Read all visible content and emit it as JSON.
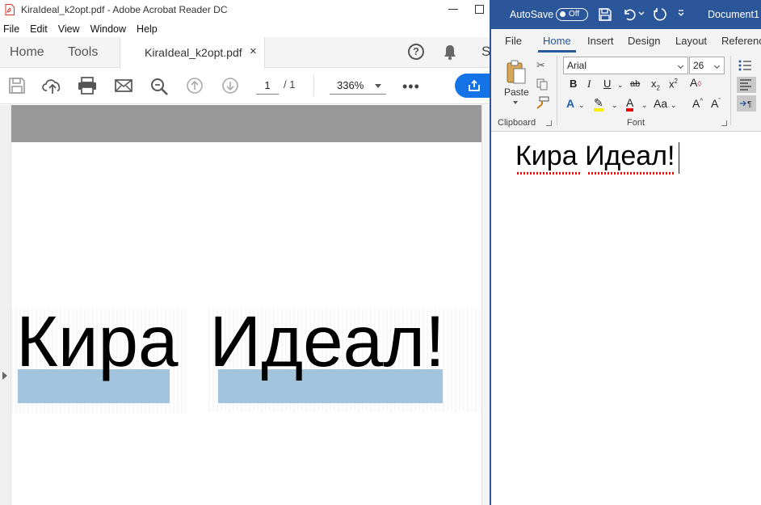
{
  "acrobat": {
    "window_title": "KiraIdeal_k2opt.pdf - Adobe Acrobat Reader DC",
    "menu": [
      "File",
      "Edit",
      "View",
      "Window",
      "Help"
    ],
    "tabs": {
      "home": "Home",
      "tools": "Tools",
      "document": "KiraIdeal_k2opt.pdf",
      "close": "×"
    },
    "share_initial": "S",
    "toolbar": {
      "page_current": "1",
      "page_total": "/ 1",
      "zoom": "336%"
    },
    "document_text": "Кира Идеал!"
  },
  "word": {
    "autosave_label": "AutoSave",
    "autosave_state": "Off",
    "doc_name": "Document1",
    "tabs": [
      "File",
      "Home",
      "Insert",
      "Design",
      "Layout",
      "Referenc"
    ],
    "active_tab": "Home",
    "clipboard": {
      "paste": "Paste",
      "group_label": "Clipboard"
    },
    "font": {
      "name": "Arial",
      "size": "26",
      "group_label": "Font"
    },
    "document_text": "Кира Идеал!"
  },
  "colors": {
    "word_blue": "#2b579a",
    "acrobat_share_blue": "#1473e6",
    "highlight": "#a2c4dc"
  }
}
